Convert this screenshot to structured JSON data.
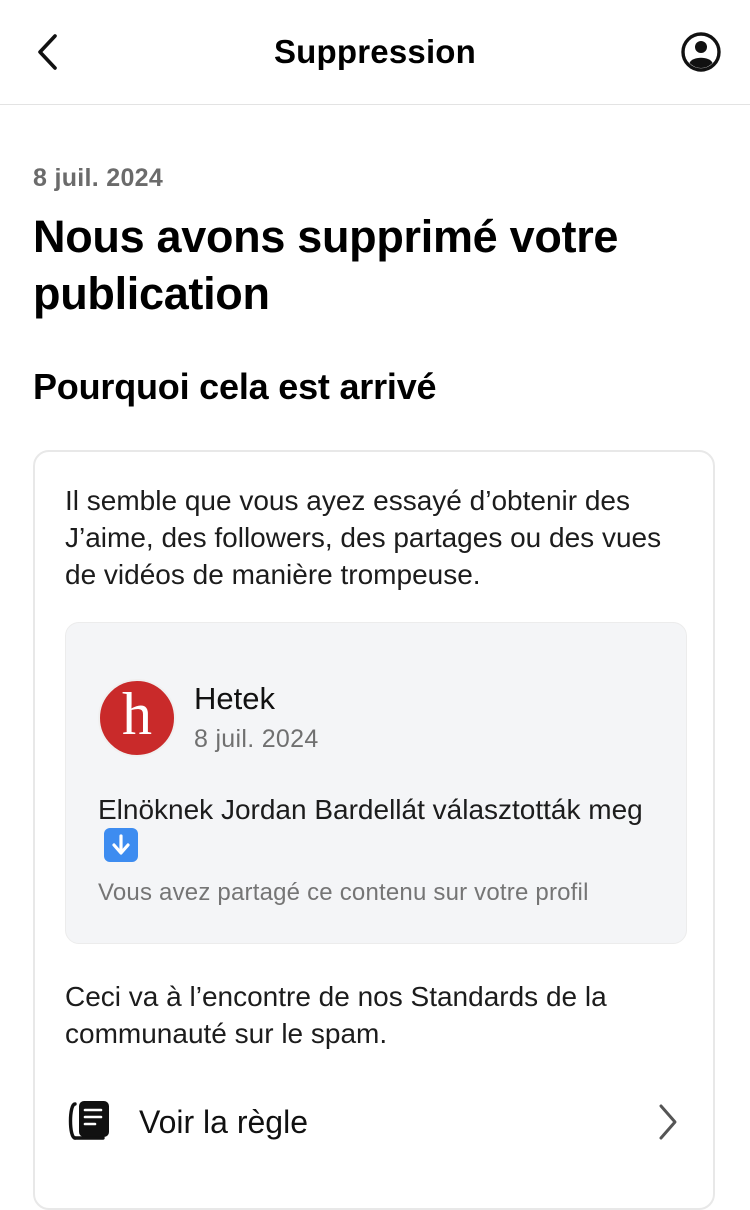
{
  "header": {
    "title": "Suppression",
    "back_icon": "chevron-left-icon",
    "profile_icon": "user-circle-icon"
  },
  "notice": {
    "date": "8 juil. 2024",
    "title": "Nous avons supprimé votre publication",
    "section_title": "Pourquoi cela est arrivé",
    "reason": "Il semble que vous ayez essayé d’obtenir des J’aime, des followers, des partages ou des vues de vidéos de manière trompeuse.",
    "post": {
      "avatar_letter": "h",
      "avatar_color": "#c92a2a",
      "author": "Hetek",
      "date": "8 juil. 2024",
      "text": "Elnöknek Jordan Bardellát választották meg",
      "emoji": "down-arrow-emoji",
      "shared_note": "Vous avez partagé ce contenu sur votre profil"
    },
    "policy_text": "Ceci va à l’encontre de nos Standards de la communauté sur le spam.",
    "rule_link": {
      "label": "Voir la règle",
      "icon": "rulebook-icon",
      "chevron": "chevron-right-icon"
    }
  }
}
